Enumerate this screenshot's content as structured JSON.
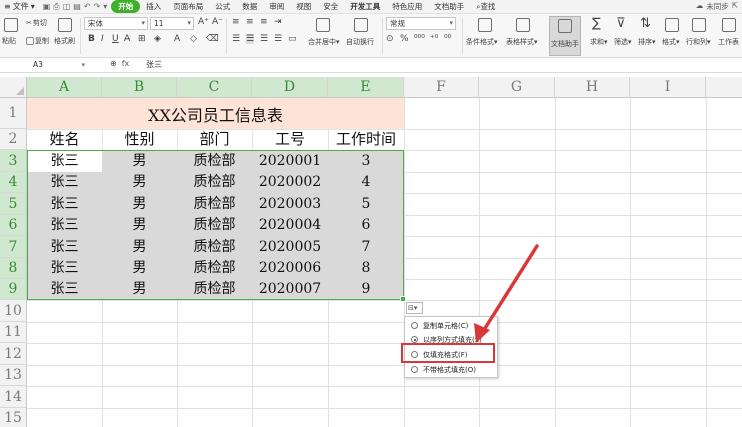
{
  "menubar": {
    "file_label": "文件",
    "tabs": [
      "开始",
      "插入",
      "页面布局",
      "公式",
      "数据",
      "审阅",
      "视图",
      "安全",
      "开发工具",
      "特色应用",
      "文档助手"
    ],
    "search_label": "查找",
    "sync_label": "未同步"
  },
  "ribbon": {
    "paste": "粘贴",
    "cut": "剪切",
    "copy": "复制",
    "format_painter": "格式刷",
    "font_name": "宋体",
    "font_size": "11",
    "number_format": "常规",
    "merge_center": "合并居中",
    "wrap_text": "自动换行",
    "cond_format": "条件格式",
    "table_style": "表格样式",
    "doc_helper": "文档助手",
    "sum": "求和",
    "filter": "筛选",
    "sort": "排序",
    "format": "格式",
    "rows_cols": "行和列",
    "worksheet": "工作表",
    "icons": [
      "paste-icon",
      "cut-icon",
      "copy-icon",
      "format-painter-icon",
      "bold-icon",
      "italic-icon",
      "underline-icon",
      "border-icon",
      "fill-color-icon",
      "font-color-icon",
      "clear-icon",
      "align-left-icon",
      "align-center-icon",
      "align-right-icon",
      "merge-center-icon",
      "wrap-text-icon",
      "percent-icon",
      "thousands-icon",
      "cond-format-icon",
      "table-style-icon",
      "doc-helper-icon",
      "sum-icon",
      "filter-icon",
      "sort-icon",
      "format-icon",
      "rows-cols-icon",
      "worksheet-icon"
    ]
  },
  "formula_bar": {
    "name_box": "A3",
    "value": "张三"
  },
  "sheet": {
    "columns": [
      "A",
      "B",
      "C",
      "D",
      "E",
      "F",
      "G",
      "H",
      "I"
    ],
    "rows": [
      "1",
      "2",
      "3",
      "4",
      "5",
      "6",
      "7",
      "8",
      "9",
      "10",
      "11",
      "12",
      "13",
      "14",
      "15"
    ],
    "title": "XX公司员工信息表",
    "headers": [
      "姓名",
      "性别",
      "部门",
      "工号",
      "工作时间"
    ],
    "data_rows": [
      [
        "张三",
        "男",
        "质检部",
        "2020001",
        "3"
      ],
      [
        "张三",
        "男",
        "质检部",
        "2020002",
        "4"
      ],
      [
        "张三",
        "男",
        "质检部",
        "2020003",
        "5"
      ],
      [
        "张三",
        "男",
        "质检部",
        "2020004",
        "6"
      ],
      [
        "张三",
        "男",
        "质检部",
        "2020005",
        "7"
      ],
      [
        "张三",
        "男",
        "质检部",
        "2020006",
        "8"
      ],
      [
        "张三",
        "男",
        "质检部",
        "2020007",
        "9"
      ]
    ]
  },
  "autofill_menu": {
    "options": [
      "复制单元格(C)",
      "以序列方式填充(S)",
      "仅填充格式(F)",
      "不带格式填充(O)"
    ],
    "selected_index": 1,
    "highlighted_index": 2,
    "highlight_color": "#d8383a"
  },
  "colors": {
    "accent_green": "#3fae2a",
    "selection_green": "#4fa94f",
    "title_band": "#fde4d6",
    "selected_fill": "#d9d9d9",
    "annotation_red": "#d8383a"
  }
}
